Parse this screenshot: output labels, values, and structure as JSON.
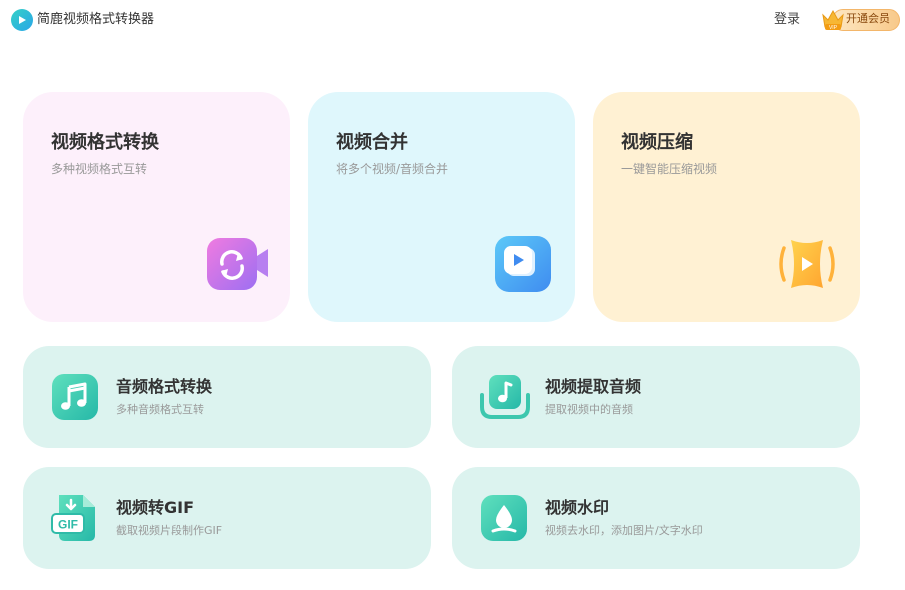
{
  "app": {
    "title": "简鹿视频格式转换器"
  },
  "header": {
    "login_label": "登录",
    "vip_label": "开通会员",
    "vip_badge": "VIP"
  },
  "colors": {
    "accent": "#2fc3c4",
    "card_pink": "#fdf0fb",
    "card_blue": "#dff7fc",
    "card_yellow": "#fff1d3",
    "card_mint": "#dcf3ef"
  },
  "features": {
    "convert": {
      "title": "视频格式转换",
      "subtitle": "多种视频格式互转",
      "icon": "refresh-video-icon"
    },
    "merge": {
      "title": "视频合并",
      "subtitle": "将多个视频/音频合并",
      "icon": "play-stack-icon"
    },
    "compress": {
      "title": "视频压缩",
      "subtitle": "一键智能压缩视频",
      "icon": "compress-play-icon"
    },
    "audio_convert": {
      "title": "音频格式转换",
      "subtitle": "多种音频格式互转",
      "icon": "music-note-icon"
    },
    "extract_audio": {
      "title": "视频提取音频",
      "subtitle": "提取视频中的音频",
      "icon": "music-extract-icon"
    },
    "to_gif": {
      "title": "视频转GIF",
      "subtitle": "截取视频片段制作GIF",
      "icon": "gif-file-icon",
      "icon_text": "GIF"
    },
    "watermark": {
      "title": "视频水印",
      "subtitle": "视频去水印，添加图片/文字水印",
      "icon": "water-drop-icon"
    }
  }
}
